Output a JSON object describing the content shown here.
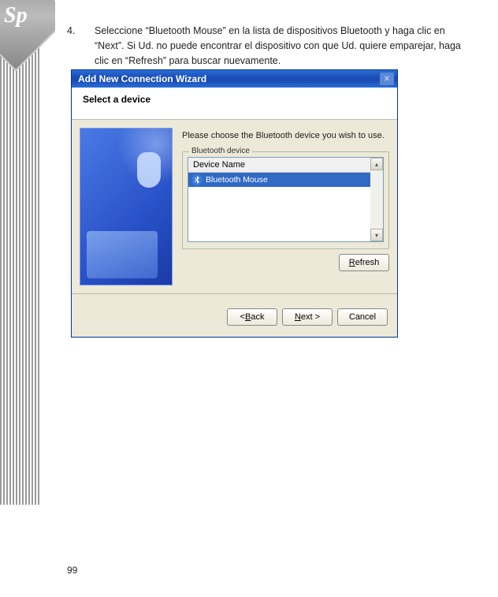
{
  "decoration": {
    "badge": "Sp"
  },
  "instruction": {
    "number": "4.",
    "text": "Seleccione “Bluetooth Mouse” en la lista de dispositivos Bluetooth y haga clic en “Next”. Si Ud. no puede encontrar el dispositivo con que Ud. quiere emparejar, haga clic en “Refresh” para buscar nuevamente."
  },
  "dialog": {
    "title": "Add New Connection Wizard",
    "subheading": "Select a device",
    "prompt": "Please choose the Bluetooth device you wish to use.",
    "group_label": "Bluetooth device",
    "list_header": "Device Name",
    "items": [
      {
        "icon": "bluetooth",
        "label": "Bluetooth Mouse",
        "selected": true
      }
    ],
    "buttons": {
      "refresh": {
        "pre": "",
        "u": "R",
        "post": "efresh"
      },
      "back": {
        "pre": "< ",
        "u": "B",
        "post": "ack"
      },
      "next": {
        "pre": "",
        "u": "N",
        "post": "ext >"
      },
      "cancel": {
        "pre": "",
        "u": "",
        "post": "Cancel"
      }
    }
  },
  "page_number": "99"
}
